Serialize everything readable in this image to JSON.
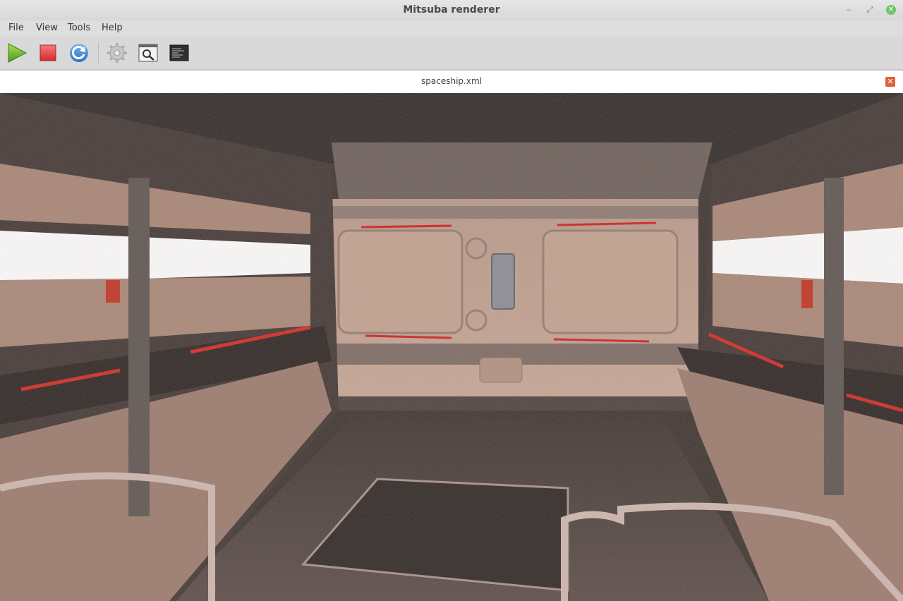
{
  "window": {
    "title": "Mitsuba renderer"
  },
  "menu": {
    "file": "File",
    "view": "View",
    "tools": "Tools",
    "help": "Help"
  },
  "toolbar": {
    "icons": [
      "play-icon",
      "stop-icon",
      "refresh-icon",
      "settings-gear-icon",
      "preview-magnifier-icon",
      "console-icon"
    ]
  },
  "tab": {
    "label": "spaceship.xml"
  },
  "colors": {
    "play": "#6cbf2a",
    "stop": "#e23b3b",
    "refresh": "#3b82d4",
    "tab_close": "#e0603c",
    "window_close": "#71c56b"
  }
}
